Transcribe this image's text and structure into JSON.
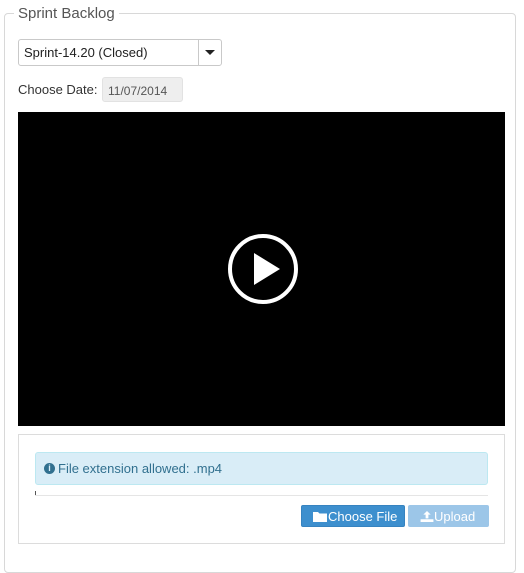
{
  "panel": {
    "legend": "Sprint Backlog"
  },
  "sprint_select": {
    "value": "Sprint-14.20 (Closed)"
  },
  "date": {
    "label": "Choose Date:",
    "value": "11/07/2014"
  },
  "video": {
    "play_icon": "play-circle-icon"
  },
  "upload": {
    "alert_icon": "info-circle-icon",
    "alert_text": "File extension allowed: .mp4",
    "choose_label": "Choose File",
    "choose_icon": "folder-icon",
    "upload_label": "Upload",
    "upload_icon": "upload-icon"
  },
  "colors": {
    "primary": "#3d8fce",
    "disabled_primary": "#9cc6e8",
    "info_bg": "#d9edf7",
    "info_text": "#31708f",
    "video_bg": "#000000"
  }
}
